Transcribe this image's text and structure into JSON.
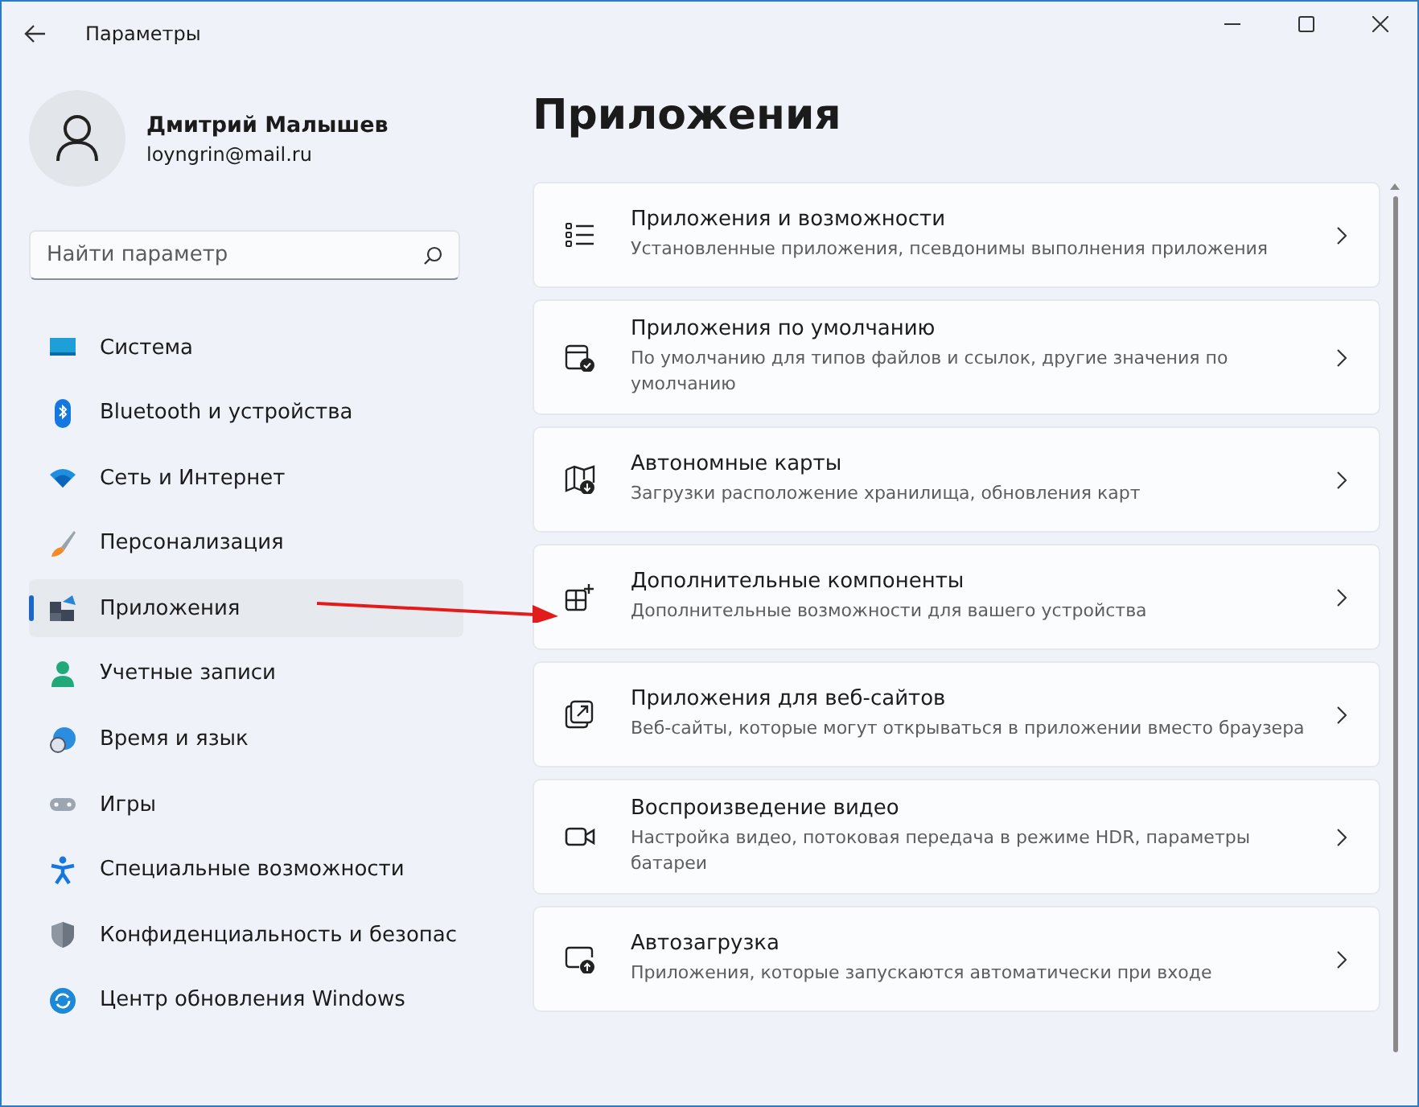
{
  "window": {
    "title": "Параметры"
  },
  "profile": {
    "name": "Дмитрий Малышев",
    "email": "loyngrin@mail.ru"
  },
  "search": {
    "placeholder": "Найти параметр"
  },
  "sidebar": {
    "items": [
      {
        "label": "Система",
        "selected": false
      },
      {
        "label": "Bluetooth и устройства",
        "selected": false
      },
      {
        "label": "Сеть и Интернет",
        "selected": false
      },
      {
        "label": "Персонализация",
        "selected": false
      },
      {
        "label": "Приложения",
        "selected": true
      },
      {
        "label": "Учетные записи",
        "selected": false
      },
      {
        "label": "Время и язык",
        "selected": false
      },
      {
        "label": "Игры",
        "selected": false
      },
      {
        "label": "Специальные возможности",
        "selected": false
      },
      {
        "label": "Конфиденциальность и безопас",
        "selected": false
      },
      {
        "label": "Центр обновления Windows",
        "selected": false
      }
    ]
  },
  "page": {
    "title": "Приложения",
    "cards": [
      {
        "title": "Приложения и возможности",
        "subtitle": "Установленные приложения, псевдонимы выполнения приложения"
      },
      {
        "title": "Приложения по умолчанию",
        "subtitle": "По умолчанию для типов файлов и ссылок, другие значения по умолчанию"
      },
      {
        "title": "Автономные карты",
        "subtitle": "Загрузки расположение хранилища, обновления карт"
      },
      {
        "title": "Дополнительные компоненты",
        "subtitle": "Дополнительные возможности для вашего устройства"
      },
      {
        "title": "Приложения для веб-сайтов",
        "subtitle": "Веб-сайты, которые могут открываться в приложении вместо браузера"
      },
      {
        "title": "Воспроизведение видео",
        "subtitle": "Настройка видео, потоковая передача в режиме HDR, параметры батареи"
      },
      {
        "title": "Автозагрузка",
        "subtitle": "Приложения, которые запускаются автоматически при входе"
      }
    ]
  }
}
